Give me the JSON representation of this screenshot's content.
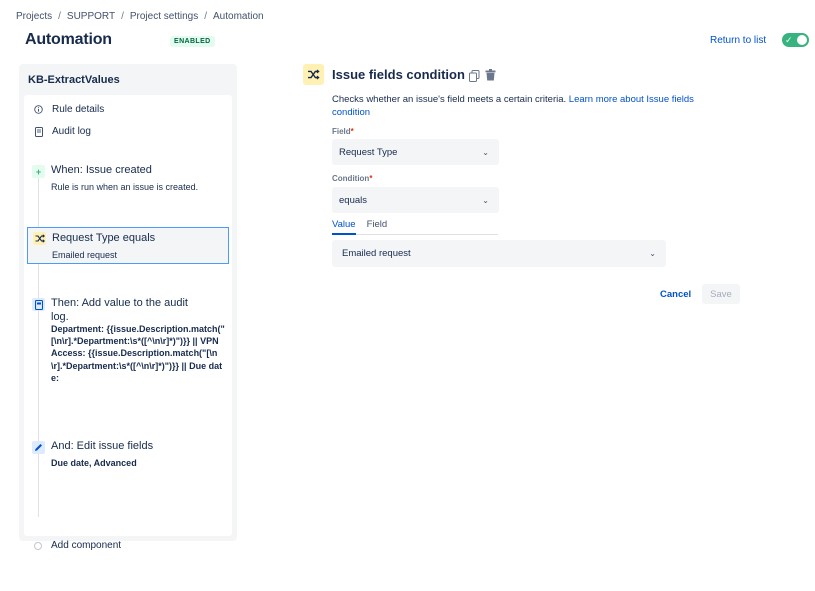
{
  "breadcrumb": [
    "Projects",
    "SUPPORT",
    "Project settings",
    "Automation"
  ],
  "breadcrumb_separator": "/",
  "header": {
    "title": "Automation",
    "status": "ENABLED",
    "return_label": "Return to list",
    "toggle_on": true
  },
  "rule": {
    "name": "KB-ExtractValues",
    "rule_details_label": "Rule details",
    "audit_log_label": "Audit log",
    "trigger": {
      "title": "When: Issue created",
      "desc": "Rule is run when an issue is created."
    },
    "condition": {
      "title": "Request Type equals",
      "desc": "Emailed request"
    },
    "action1": {
      "title": "Then: Add value to the audit log.",
      "code": "Department: {{issue.Description.match(\"[\\n\\r].*Department:\\s*([^\\n\\r]*)\")}} || VPN Access: {{issue.Description.match(\"[\\n\\r].*Department:\\s*([^\\n\\r]*)\")}} || Due date:"
    },
    "action2": {
      "title": "And: Edit issue fields",
      "desc": "Due date, Advanced"
    },
    "add_component_label": "Add component"
  },
  "editor": {
    "title": "Issue fields condition",
    "description": "Checks whether an issue's field meets a certain criteria.",
    "learn_more": "Learn more about Issue fields condition",
    "field_label": "Field",
    "field_value": "Request Type",
    "condition_label": "Condition",
    "condition_value": "equals",
    "tabs": [
      "Value",
      "Field"
    ],
    "active_tab": "Value",
    "value_value": "Emailed request",
    "required_marker": "*",
    "cancel_label": "Cancel",
    "save_label": "Save"
  },
  "colors": {
    "accent": "#0052cc",
    "toggle": "#36b37e",
    "condition_icon_bg": "#fff0b3",
    "selected_border": "#4c9aff"
  },
  "icons": {
    "rule_details": "info-icon",
    "audit_log": "document-icon",
    "trigger": "plus-icon",
    "condition": "shuffle-icon",
    "action1": "audit-log-icon",
    "action2": "pencil-icon"
  }
}
